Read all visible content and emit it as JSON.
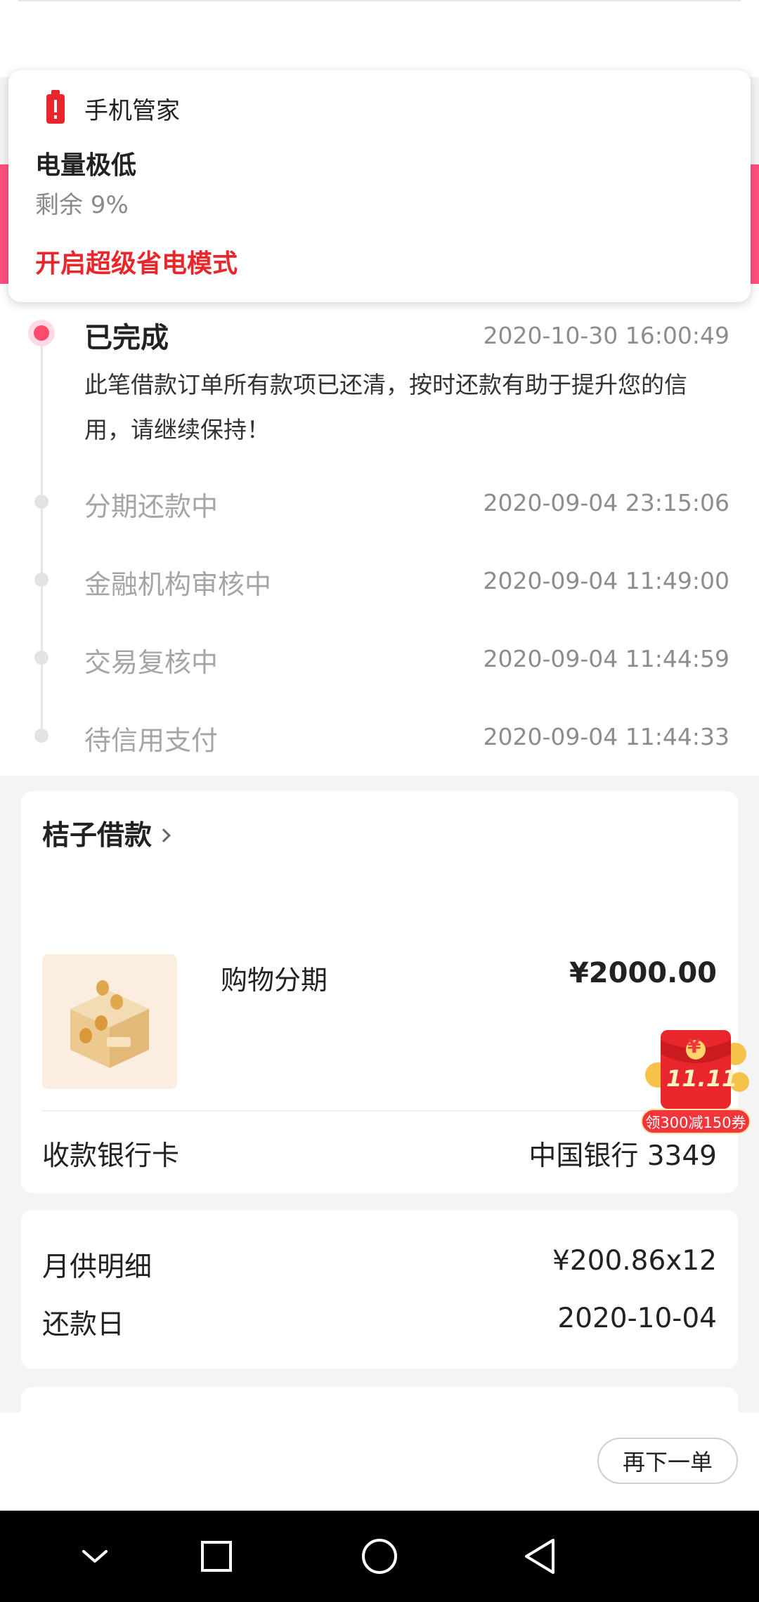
{
  "notification": {
    "app_name": "手机管家",
    "title": "电量极低",
    "body": "剩余 9%",
    "action": "开启超级省电模式",
    "icon": "battery-low-icon"
  },
  "timeline": {
    "current": {
      "status": "已完成",
      "time": "2020-10-30 16:00:49",
      "description": "此笔借款订单所有款项已还清，按时还款有助于提升您的信用，请继续保持！"
    },
    "steps": [
      {
        "status": "分期还款中",
        "time": "2020-09-04 23:15:06"
      },
      {
        "status": "金融机构审核中",
        "time": "2020-09-04 11:49:00"
      },
      {
        "status": "交易复核中",
        "time": "2020-09-04 11:44:59"
      },
      {
        "status": "待信用支付",
        "time": "2020-09-04 11:44:33"
      }
    ]
  },
  "loan_card": {
    "merchant": "桔子借款",
    "product_name": "购物分期",
    "price": "¥2000.00",
    "bank_label": "收款银行卡",
    "bank_value": "中国银行 3349"
  },
  "detail_card": {
    "monthly_label": "月供明细",
    "monthly_value": "¥200.86x12",
    "due_label": "还款日",
    "due_value": "2020-10-04"
  },
  "promo": {
    "badge": "11.11",
    "label": "领300减150券",
    "yen": "¥"
  },
  "actions": {
    "reorder": "再下一单"
  },
  "navbar": {
    "icons": [
      "chevron-down-icon",
      "square-icon",
      "circle-home-icon",
      "triangle-back-icon"
    ]
  },
  "colors": {
    "accent_pink": "#ff4f7f",
    "active_dot": "#ff4a6e",
    "warning_red": "#e8262b"
  }
}
